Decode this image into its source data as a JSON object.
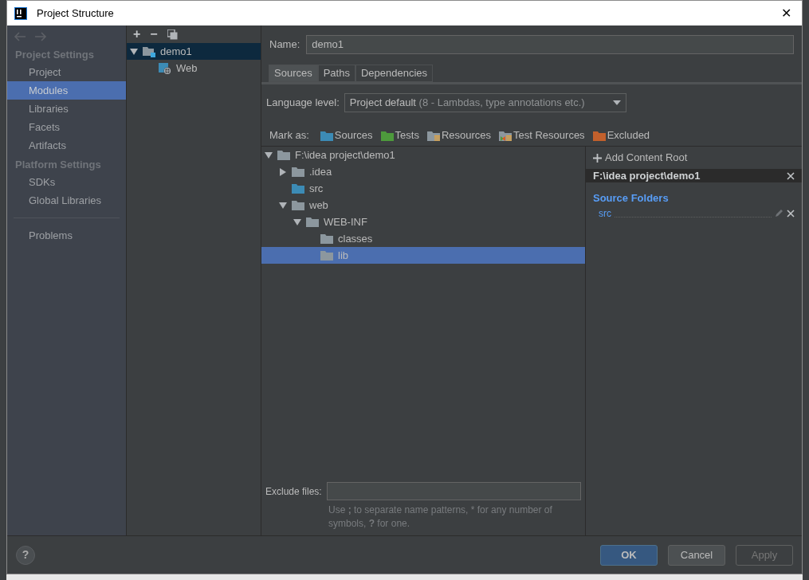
{
  "window": {
    "title": "Project Structure",
    "close": "✕"
  },
  "sidebar": {
    "sections": [
      {
        "heading": "Project Settings",
        "items": [
          {
            "label": "Project",
            "selected": false
          },
          {
            "label": "Modules",
            "selected": true
          },
          {
            "label": "Libraries",
            "selected": false
          },
          {
            "label": "Facets",
            "selected": false
          },
          {
            "label": "Artifacts",
            "selected": false
          }
        ]
      },
      {
        "heading": "Platform Settings",
        "items": [
          {
            "label": "SDKs",
            "selected": false
          },
          {
            "label": "Global Libraries",
            "selected": false
          }
        ]
      }
    ],
    "footer_items": [
      {
        "label": "Problems",
        "selected": false
      }
    ]
  },
  "module_tree": {
    "toolbar": [
      "+",
      "−"
    ],
    "nodes": [
      {
        "label": "demo1",
        "kind": "module",
        "selected": true,
        "expanded": true,
        "children": [
          {
            "label": "Web",
            "kind": "web",
            "selected": false
          }
        ]
      }
    ]
  },
  "name": {
    "label": "Name:",
    "value": "demo1"
  },
  "tabs": [
    {
      "label": "Sources",
      "selected": true
    },
    {
      "label": "Paths",
      "selected": false
    },
    {
      "label": "Dependencies",
      "selected": false
    }
  ],
  "language_level": {
    "label": "Language level:",
    "value": "Project default",
    "detail": "(8 - Lambdas, type annotations etc.)"
  },
  "mark_as": {
    "label": "Mark as:",
    "items": [
      {
        "label": "Sources",
        "kind": "plain",
        "color": "#3c8bb5"
      },
      {
        "label": "Tests",
        "kind": "plain",
        "color": "#4d9a3c"
      },
      {
        "label": "Resources",
        "kind": "resources",
        "color": "#8c979e"
      },
      {
        "label": "Test Resources",
        "kind": "test-resources",
        "color": "#8c979e"
      },
      {
        "label": "Excluded",
        "kind": "plain",
        "color": "#c2602c"
      }
    ]
  },
  "file_tree": [
    {
      "label": "F:\\idea project\\demo1",
      "kind": "folder",
      "selected": false,
      "expanded": true,
      "children": [
        {
          "label": ".idea",
          "kind": "folder",
          "selected": false,
          "expanded": false
        },
        {
          "label": "src",
          "kind": "source",
          "selected": false
        },
        {
          "label": "web",
          "kind": "folder",
          "selected": false,
          "expanded": true,
          "children": [
            {
              "label": "WEB-INF",
              "kind": "folder",
              "selected": false,
              "expanded": true,
              "children": [
                {
                  "label": "classes",
                  "kind": "folder",
                  "selected": false
                },
                {
                  "label": "lib",
                  "kind": "folder",
                  "selected": true
                }
              ]
            }
          ]
        }
      ]
    }
  ],
  "content_roots": {
    "add": {
      "label": "Add Content Root"
    },
    "root": "F:\\idea project\\demo1",
    "section": "Source Folders",
    "folders": [
      "src"
    ]
  },
  "exclude_files": {
    "label": "Exclude files:",
    "hint": "Use **;** to separate name patterns, * for any number of symbols, **?** for one."
  },
  "buttons": [
    {
      "label": "?",
      "kind": "help"
    },
    {
      "label": "OK",
      "kind": "default",
      "disabled": false
    },
    {
      "label": "Cancel",
      "kind": "normal",
      "disabled": false
    },
    {
      "label": "Apply",
      "kind": "normal",
      "disabled": true
    }
  ]
}
